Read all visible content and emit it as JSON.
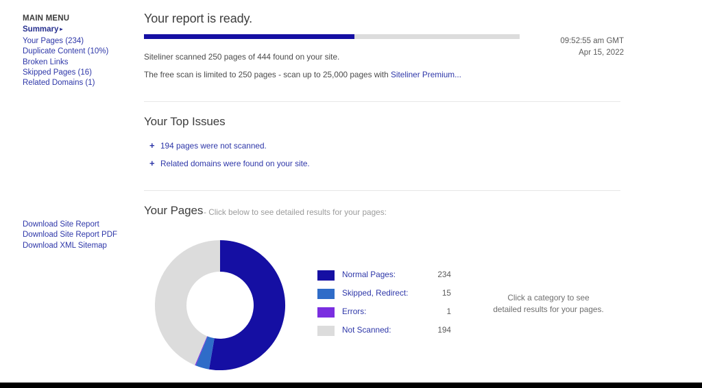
{
  "sidebar": {
    "menu_title": "MAIN MENU",
    "summary_label": "Summary",
    "summary_caret": "▸",
    "items": [
      {
        "label": "Your Pages (234)"
      },
      {
        "label": "Duplicate Content (10%)"
      },
      {
        "label": "Broken Links"
      },
      {
        "label": "Skipped Pages (16)"
      },
      {
        "label": "Related Domains (1)"
      }
    ],
    "downloads": [
      {
        "label": "Download Site Report"
      },
      {
        "label": "Download Site Report PDF"
      },
      {
        "label": "Download XML Sitemap"
      }
    ]
  },
  "report": {
    "title": "Your report is ready.",
    "progress_percent": 56,
    "scan_summary": "Siteliner scanned 250 pages of 444 found on your site.",
    "limit_text": "The free scan is limited to 250 pages - scan up to 25,000 pages with ",
    "premium_link": "Siteliner Premium...",
    "time": "09:52:55 am GMT",
    "date": "Apr 15, 2022"
  },
  "issues": {
    "title": "Your Top Issues",
    "expand_icon": "+",
    "items": [
      {
        "label": "194 pages were not scanned."
      },
      {
        "label": "Related domains were found on your site."
      }
    ]
  },
  "pages": {
    "title": "Your Pages",
    "subtitle": "-  Click below to see detailed results for your pages:",
    "hint_line1": "Click a category to see",
    "hint_line2": "detailed results for your pages."
  },
  "chart_data": {
    "type": "pie",
    "title": "Your Pages",
    "variant": "donut",
    "start_angle_deg": 0,
    "direction": "clockwise",
    "total": 444,
    "categories": [
      "Normal Pages",
      "Skipped, Redirect",
      "Errors",
      "Not Scanned"
    ],
    "values": [
      234,
      15,
      1,
      194
    ],
    "colors": [
      "#150fa3",
      "#2f6cc8",
      "#7a2ee0",
      "#dcdcdc"
    ],
    "legend_position": "right",
    "legend": [
      {
        "label": "Normal Pages:",
        "value": "234",
        "color": "#150fa3"
      },
      {
        "label": "Skipped, Redirect:",
        "value": "15",
        "color": "#2f6cc8"
      },
      {
        "label": "Errors:",
        "value": "1",
        "color": "#7a2ee0"
      },
      {
        "label": "Not Scanned:",
        "value": "194",
        "color": "#dcdcdc"
      }
    ]
  }
}
